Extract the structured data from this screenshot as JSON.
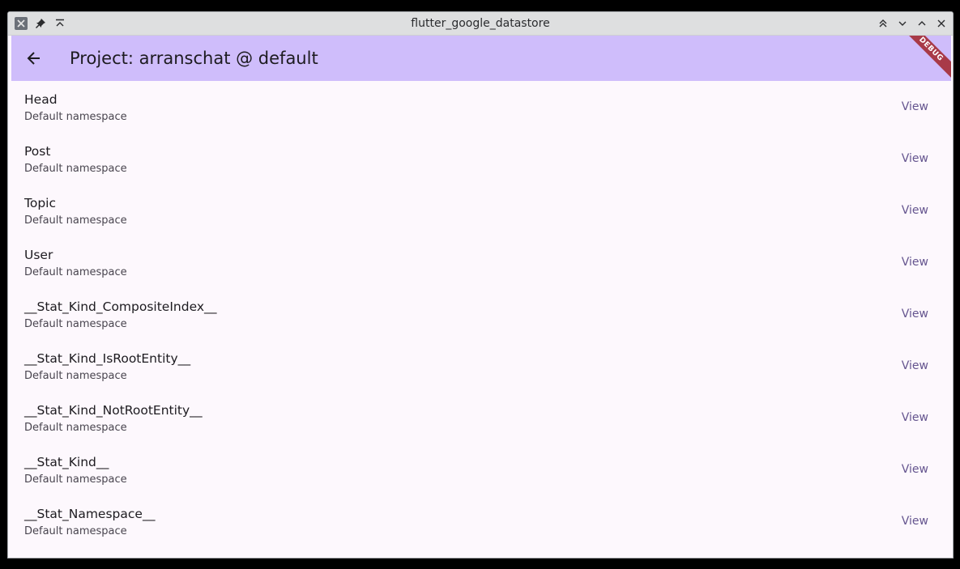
{
  "window": {
    "title": "flutter_google_datastore"
  },
  "appbar": {
    "title": "Project: arranschat @ default",
    "debug_label": "DEBUG"
  },
  "colors": {
    "appbar_bg": "#cfbdfb",
    "debug_banner": "#a83a48",
    "view_button": "#65558f",
    "page_bg": "#fdf8fd"
  },
  "items": [
    {
      "name": "Head",
      "subtitle": "Default namespace",
      "action": "View"
    },
    {
      "name": "Post",
      "subtitle": "Default namespace",
      "action": "View"
    },
    {
      "name": "Topic",
      "subtitle": "Default namespace",
      "action": "View"
    },
    {
      "name": "User",
      "subtitle": "Default namespace",
      "action": "View"
    },
    {
      "name": "__Stat_Kind_CompositeIndex__",
      "subtitle": "Default namespace",
      "action": "View"
    },
    {
      "name": "__Stat_Kind_IsRootEntity__",
      "subtitle": "Default namespace",
      "action": "View"
    },
    {
      "name": "__Stat_Kind_NotRootEntity__",
      "subtitle": "Default namespace",
      "action": "View"
    },
    {
      "name": "__Stat_Kind__",
      "subtitle": "Default namespace",
      "action": "View"
    },
    {
      "name": "__Stat_Namespace__",
      "subtitle": "Default namespace",
      "action": "View"
    }
  ]
}
